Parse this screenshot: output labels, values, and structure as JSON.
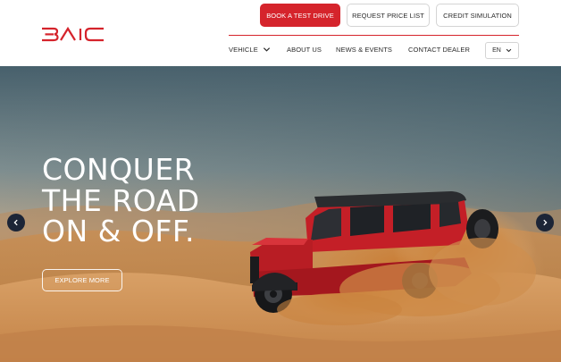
{
  "brand": {
    "logo_text": "BAIC",
    "logo_color": "#d5242c"
  },
  "header": {
    "top_buttons": {
      "test_drive": "BOOK A TEST DRIVE",
      "price_list": "REQUEST PRICE LIST",
      "credit": "CREDIT SIMULATION"
    },
    "nav": {
      "vehicle": "VEHICLE",
      "about": "ABOUT US",
      "news": "NEWS & EVENTS",
      "contact": "CONTACT DEALER"
    },
    "language": "EN"
  },
  "hero": {
    "headline_lines": [
      "CONQUER",
      "THE ROAD",
      "ON & OFF."
    ],
    "cta": "EXPLORE MORE",
    "icons": {
      "prev": "chevron-left-icon",
      "next": "chevron-right-icon"
    }
  },
  "colors": {
    "accent": "#d5242c",
    "arrow_bg": "#1c2537",
    "text": "#2a2a2a"
  }
}
